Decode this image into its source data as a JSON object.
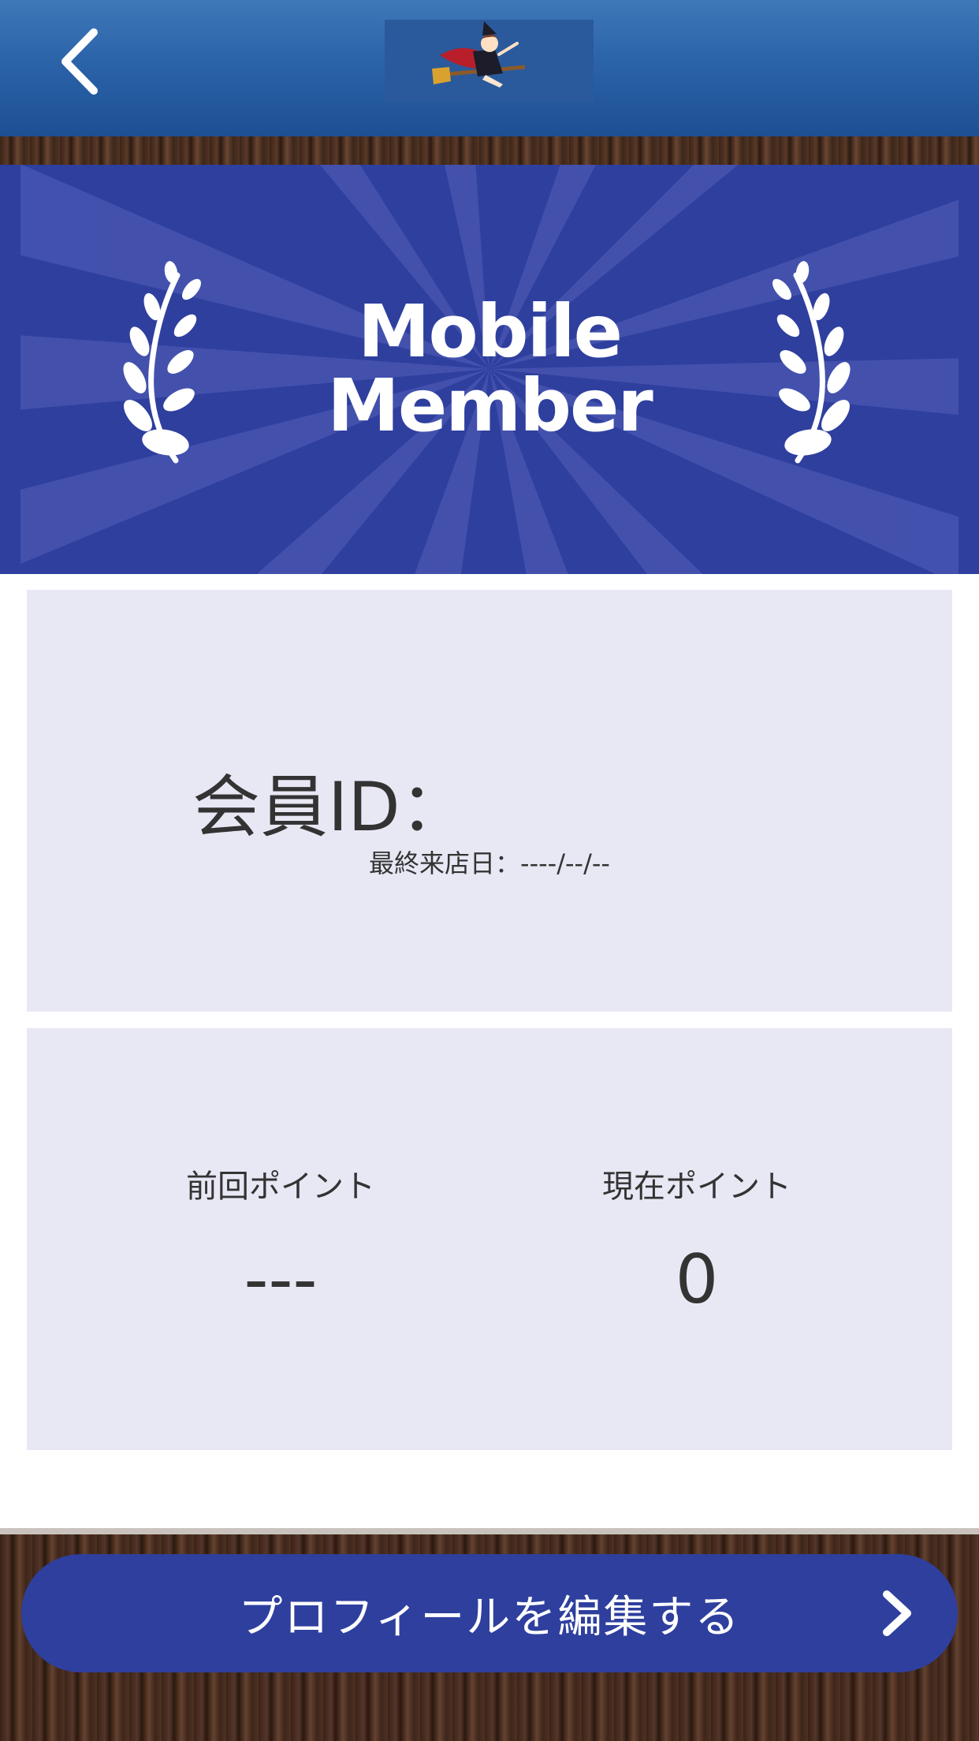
{
  "header": {
    "back_icon": "chevron-left-icon",
    "logo_icon": "witch-on-broom-logo"
  },
  "banner": {
    "title_line1": "Mobile",
    "title_line2": "Member"
  },
  "member": {
    "id_label": "会員ID：",
    "last_visit": "最終来店日：----/--/--"
  },
  "points": {
    "previous_label": "前回ポイント",
    "previous_value": "---",
    "current_label": "現在ポイント",
    "current_value": "0"
  },
  "footer": {
    "edit_profile_label": "プロフィールを編集する",
    "chevron_icon": "chevron-right-icon"
  },
  "colors": {
    "header_blue": "#2b63a9",
    "banner_blue": "#2e3f9e",
    "card_bg": "#e8e8f5",
    "text": "#333333"
  }
}
